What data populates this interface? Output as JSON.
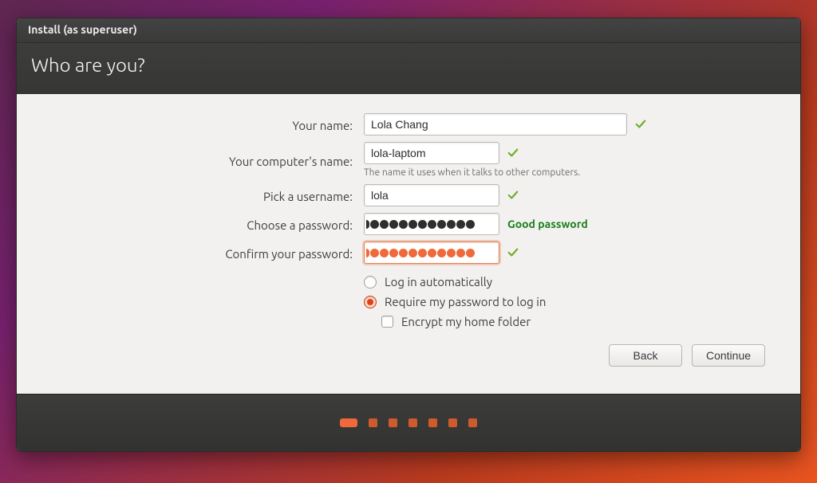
{
  "window": {
    "title": "Install (as superuser)"
  },
  "header": {
    "title": "Who are you?"
  },
  "form": {
    "name": {
      "label": "Your name:",
      "value": "Lola Chang"
    },
    "host": {
      "label": "Your computer's name:",
      "value": "lola-laptom",
      "hint": "The name it uses when it talks to other computers."
    },
    "user": {
      "label": "Pick a username:",
      "value": "lola"
    },
    "pass": {
      "label": "Choose a password:",
      "strength": "Good password"
    },
    "confirm": {
      "label": "Confirm your password:"
    },
    "login_auto": "Log in automatically",
    "login_require": "Require my password to log in",
    "encrypt_home": "Encrypt my home folder"
  },
  "buttons": {
    "back": "Back",
    "continue": "Continue"
  },
  "progress": {
    "total": 7,
    "active": 0
  },
  "password_dots": {
    "choose": 12,
    "confirm": 12
  }
}
